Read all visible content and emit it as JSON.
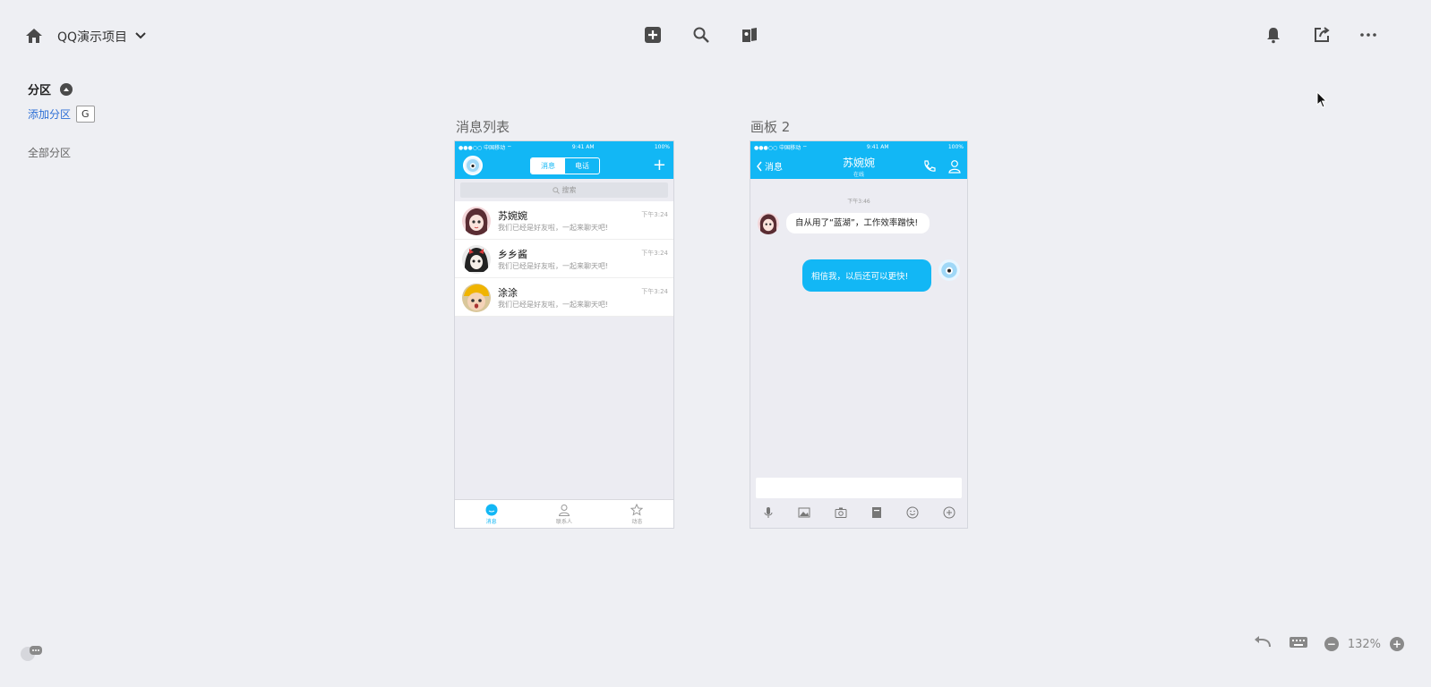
{
  "header": {
    "project_name": "QQ演示项目",
    "icons": [
      "home-icon",
      "chevron-down-icon",
      "add-square-icon",
      "search-icon",
      "components-icon",
      "bell-icon",
      "share-icon",
      "more-icon"
    ]
  },
  "sidebar": {
    "section_title": "分区",
    "add_section_label": "添加分区",
    "shortcut_key": "G",
    "all_sections_label": "全部分区"
  },
  "artboards": [
    {
      "name": "消息列表",
      "status": {
        "carrier": "●●●○○ 中国移动 ⌔",
        "time": "9:41 AM",
        "battery": "100%"
      },
      "segments": [
        "消息",
        "电话"
      ],
      "search_placeholder": "搜索",
      "conversations": [
        {
          "name": "苏婉婉",
          "preview": "我们已经是好友啦，一起来聊天吧!",
          "time": "下午3:24"
        },
        {
          "name": "乡乡酱",
          "preview": "我们已经是好友啦，一起来聊天吧!",
          "time": "下午3:24"
        },
        {
          "name": "涂涂",
          "preview": "我们已经是好友啦，一起来聊天吧!",
          "time": "下午3:24"
        }
      ],
      "tabs": [
        "消息",
        "联系人",
        "动态"
      ]
    },
    {
      "name": "画板 2",
      "status": {
        "carrier": "●●●○○ 中国移动 ⌔",
        "time": "9:41 AM",
        "battery": "100%"
      },
      "back_label": "消息",
      "contact_name": "苏婉婉",
      "contact_subtitle": "在线",
      "timestamp": "下午3:46",
      "incoming_message": "自从用了“蓝湖”，工作效率蹭快!",
      "outgoing_message": "相信我，以后还可以更快!"
    }
  ],
  "footer": {
    "zoom": "132%"
  },
  "colors": {
    "qq_blue": "#12b7f5",
    "canvas_bg": "#eeeff3",
    "link_blue": "#2d6fd6"
  }
}
